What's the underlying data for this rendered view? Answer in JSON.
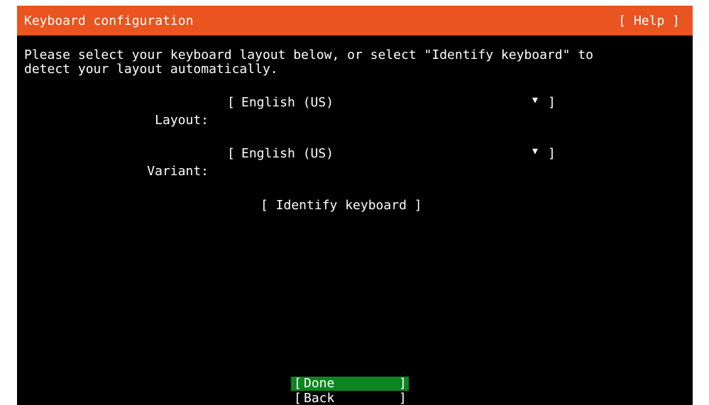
{
  "header": {
    "title": "Keyboard configuration",
    "help_label": "[ Help ]"
  },
  "intro_text": "Please select your keyboard layout below, or select \"Identify keyboard\" to\ndetect your layout automatically.",
  "fields": {
    "layout": {
      "label": "Layout:",
      "value": "English (US)",
      "open": "[",
      "close": "]",
      "arrow": "▼"
    },
    "variant": {
      "label": "Variant:",
      "value": "English (US)",
      "open": "[",
      "close": "]",
      "arrow": "▼"
    }
  },
  "identify_button_label": "[ Identify keyboard ]",
  "footer": {
    "done": {
      "open": "[",
      "label": "Done",
      "close": "]"
    },
    "back": {
      "open": "[",
      "label": "Back",
      "close": "]"
    }
  },
  "colors": {
    "header_bg": "#e95420",
    "screen_bg": "#000000",
    "done_bg": "#0e8420",
    "text": "#ffffff"
  }
}
